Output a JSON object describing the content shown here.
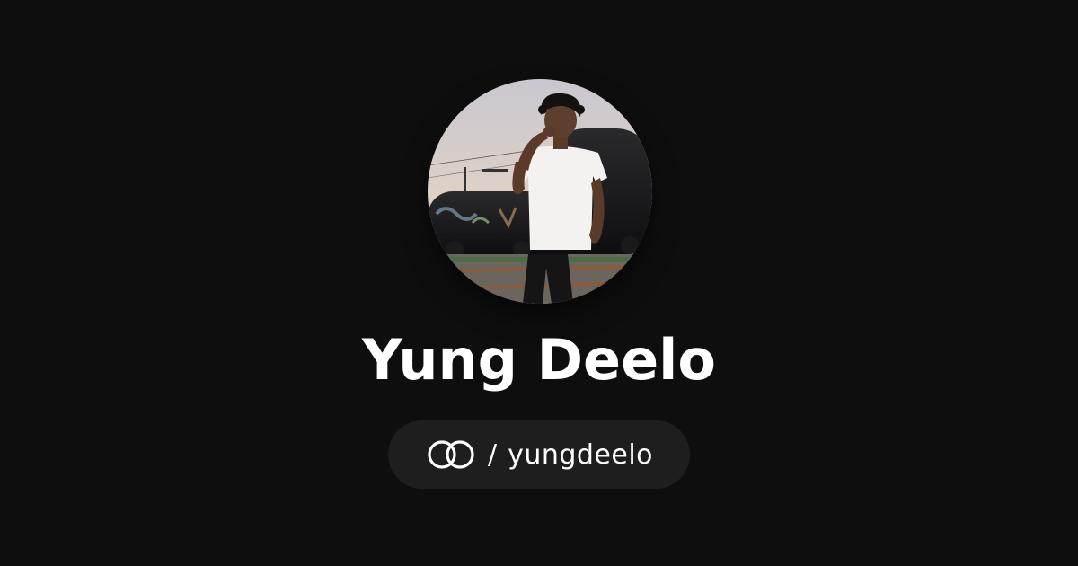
{
  "profile": {
    "name": "Yung Deelo",
    "handle_separator": "/",
    "handle": "yungdeelo",
    "logo_icon": "linked-circles-icon"
  },
  "colors": {
    "background": "#0f0e0f",
    "pill": "#1f1e1f",
    "text": "#ffffff"
  }
}
